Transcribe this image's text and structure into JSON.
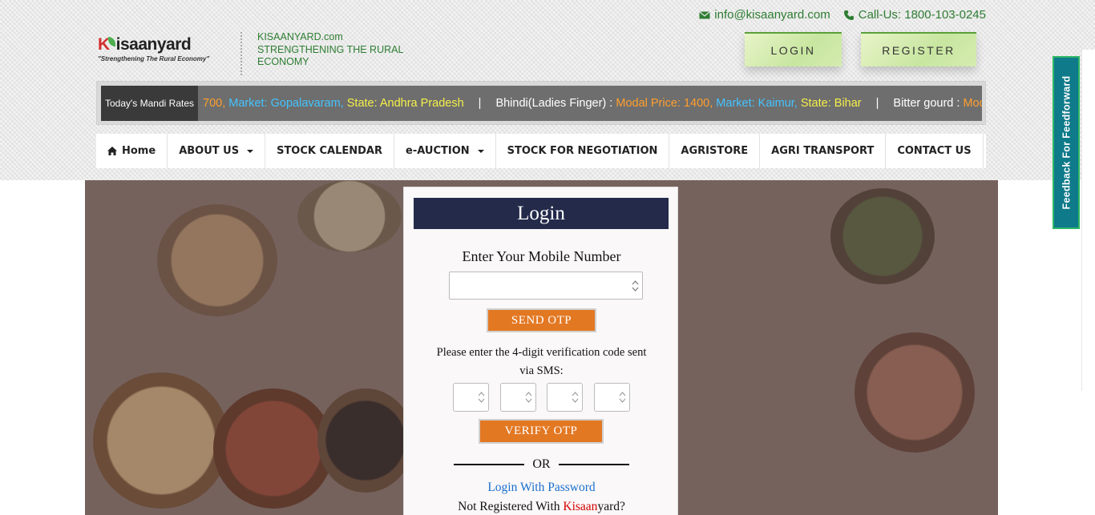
{
  "header": {
    "email": "info@kisaanyard.com",
    "phone": "Call-Us: 1800-103-0245",
    "logo_text": "Kisaanyard",
    "logo_tagline": "\"Strengthening The Rural Economy\"",
    "tagline_line1": "KISAANYARD.com",
    "tagline_line2": "STRENGTHENING THE RURAL",
    "tagline_line3": "ECONOMY",
    "login_label": "LOGIN",
    "register_label": "REGISTER",
    "colors": {
      "brand_green": "#2e7d32",
      "navy": "#232a4a",
      "orange": "#e37823"
    }
  },
  "ticker": {
    "label": "Today's Mandi Rates",
    "items": [
      {
        "crop": "",
        "price": "700,",
        "market": "Market: Gopalavaram,",
        "state": "State: Andhra Pradesh"
      },
      {
        "crop": "Bhindi(Ladies Finger) : ",
        "price": "Modal Price: 1400,",
        "market": "Market: Kaimur,",
        "state": "State: Bihar"
      },
      {
        "crop": "Bitter gourd : ",
        "price": "Moc",
        "market": "",
        "state": ""
      }
    ],
    "separator": "|"
  },
  "nav": {
    "home": "Home",
    "about": "ABOUT US",
    "stock_calendar": "STOCK CALENDAR",
    "eauction": "e-AUCTION",
    "negotiation": "STOCK FOR NEGOTIATION",
    "agristore": "AGRISTORE",
    "transport": "AGRI TRANSPORT",
    "contact": "CONTACT US"
  },
  "login": {
    "title": "Login",
    "mobile_label": "Enter Your Mobile Number",
    "mobile_value": "",
    "send_otp": "SEND OTP",
    "otp_note": "Please enter the 4-digit verification code sent via SMS:",
    "verify_otp": "VERIFY OTP",
    "or": "OR",
    "login_with_password": "Login With Password",
    "not_registered_prefix": "Not Registered With ",
    "not_registered_brand": "Kisaan",
    "not_registered_suffix": "yard?"
  },
  "feedback": {
    "label": "Feedback For Feedforward"
  }
}
